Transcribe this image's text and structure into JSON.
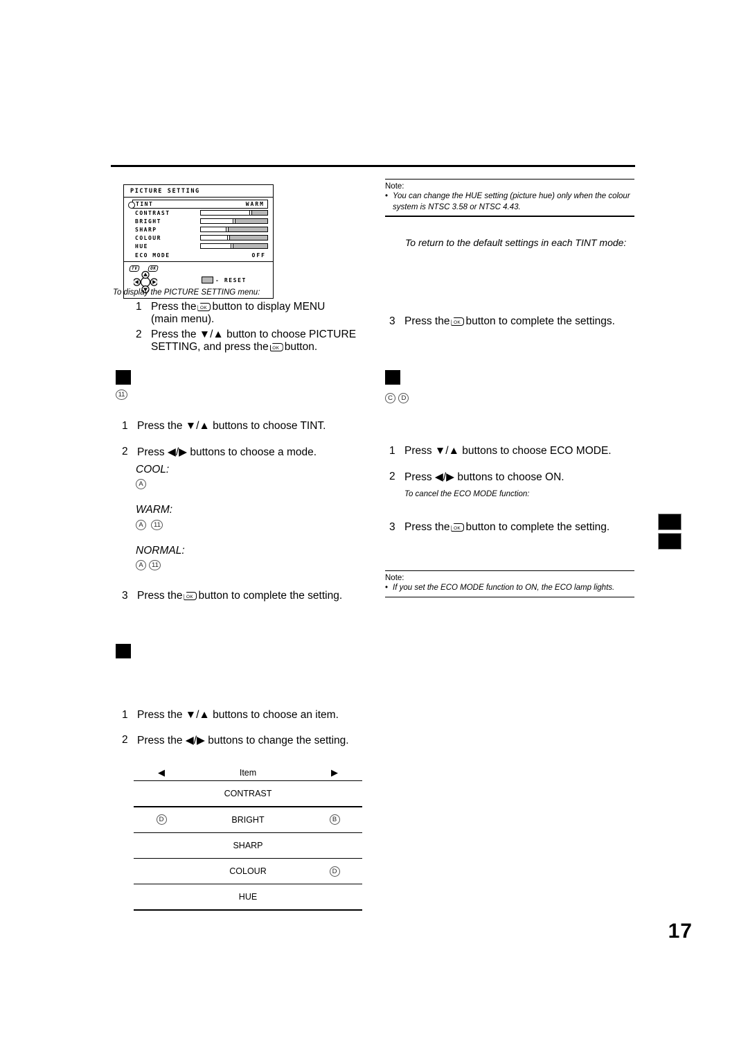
{
  "osd": {
    "title": "PICTURE SETTING",
    "tint": {
      "label": "TINT",
      "value": "WARM"
    },
    "sliders": [
      {
        "label": "CONTRAST",
        "percent": 75
      },
      {
        "label": "BRIGHT",
        "percent": 50
      },
      {
        "label": "SHARP",
        "percent": 40
      },
      {
        "label": "COLOUR",
        "percent": 42
      },
      {
        "label": "HUE",
        "percent": 47
      }
    ],
    "eco": {
      "label": "ECO MODE",
      "value": "OFF"
    },
    "footer": {
      "tv_chip": "TV",
      "ok_chip": "OK",
      "reset_label": "- RESET"
    }
  },
  "left": {
    "display_caption": "To display the PICTURE SETTING menu:",
    "display_steps": [
      {
        "num": "1",
        "before": "Press the",
        "icon": "ok-button-icon",
        "after": "button to display MENU (main menu)."
      },
      {
        "num": "2",
        "before": "Press the ▼/▲ button to choose PICTURE SETTING, and press the",
        "icon": "ok-button-icon",
        "after": "button."
      }
    ],
    "tint_marker": "11",
    "tint_steps": [
      {
        "num": "1",
        "text": "Press the ▼/▲ buttons to choose TINT."
      },
      {
        "num": "2",
        "text": "Press ◀/▶ buttons to choose a mode."
      }
    ],
    "modes": [
      {
        "name": "COOL:",
        "markers": [
          "A"
        ]
      },
      {
        "name": "WARM:",
        "markers": [
          "A",
          "11"
        ]
      },
      {
        "name": "NORMAL:",
        "markers": [
          "A",
          "11"
        ]
      }
    ],
    "tint_step3": {
      "num": "3",
      "before": "Press the",
      "icon": "ok-button-icon",
      "after": "button to complete the setting."
    },
    "item_steps": [
      {
        "num": "1",
        "text": "Press the ▼/▲ buttons to choose an item."
      },
      {
        "num": "2",
        "text": "Press the ◀/▶ buttons to change the setting."
      }
    ]
  },
  "table": {
    "header": {
      "left": "◀",
      "mid": "Item",
      "right": "▶"
    },
    "rows": [
      {
        "left": "",
        "item": "CONTRAST",
        "right": ""
      },
      {
        "left": "D",
        "item": "BRIGHT",
        "right": "B"
      },
      {
        "left": "",
        "item": "SHARP",
        "right": ""
      },
      {
        "left": "",
        "item": "COLOUR",
        "right": "D"
      },
      {
        "left": "",
        "item": "HUE",
        "right": ""
      }
    ]
  },
  "right": {
    "note1": {
      "label": "Note:",
      "bullet": "•",
      "text": "You can change the HUE setting (picture hue) only when the colour system is  NTSC 3.58 or NTSC 4.43."
    },
    "default_heading": "To return to the default settings in each TINT mode:",
    "step3_tint": {
      "num": "3",
      "before": "Press the",
      "icon": "ok-button-icon",
      "after": "button to complete the settings."
    },
    "eco_markers": [
      "C",
      "D"
    ],
    "eco_steps": [
      {
        "num": "1",
        "text": "Press ▼/▲ buttons to choose ECO MODE."
      },
      {
        "num": "2",
        "text": "Press ◀/▶ buttons to choose ON."
      }
    ],
    "cancel_caption": "To cancel the ECO MODE function:",
    "step3_eco": {
      "num": "3",
      "before": "Press the",
      "icon": "ok-button-icon",
      "after": "button to complete the setting."
    },
    "note2": {
      "label": "Note:",
      "bullet": "•",
      "text": "If you set the ECO MODE function to ON, the ECO lamp lights."
    }
  },
  "page_number": "17"
}
